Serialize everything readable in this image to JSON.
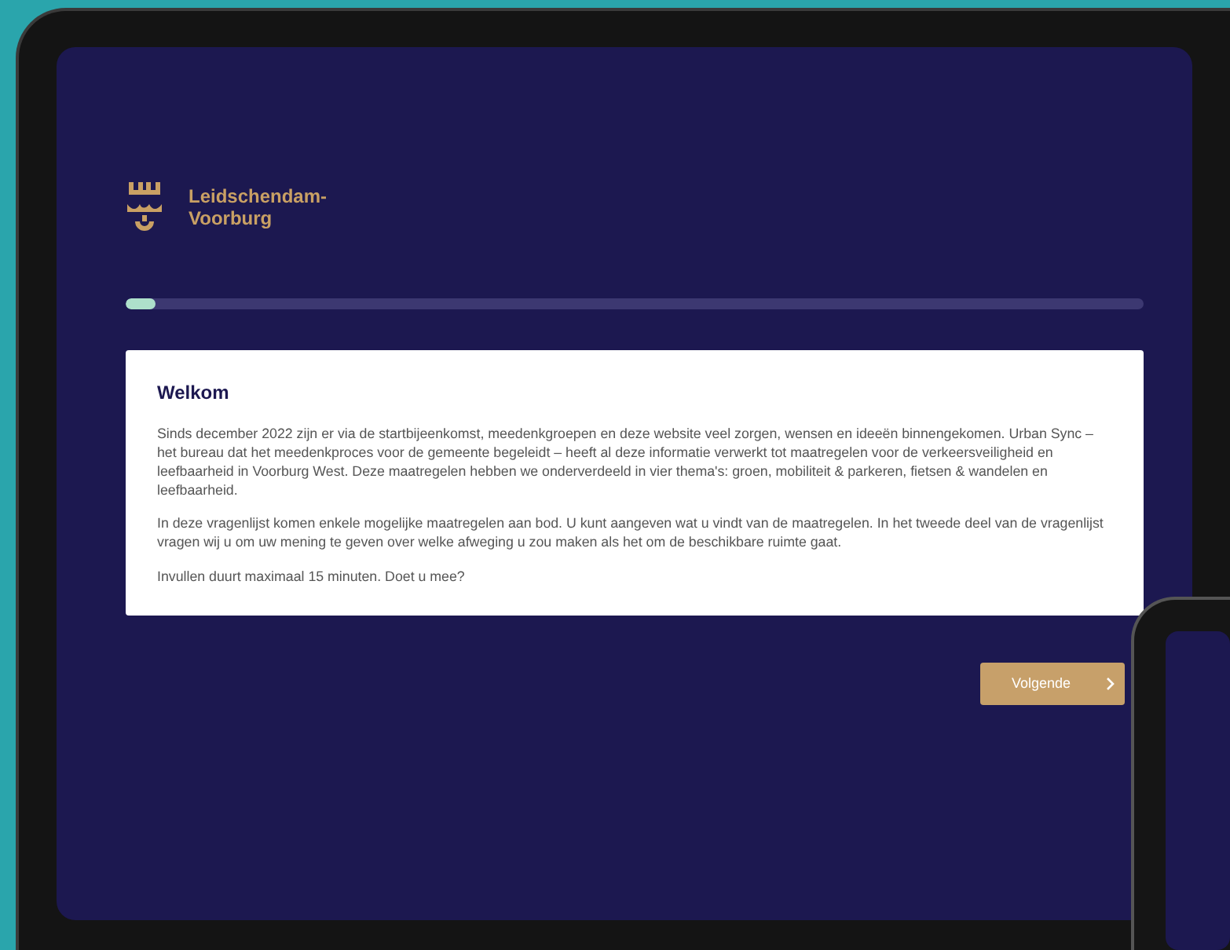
{
  "logo": {
    "lines": [
      "Leidschendam-",
      "Voorburg"
    ]
  },
  "progress": {
    "level": 0.03
  },
  "intro_card": {
    "title": "Welkom",
    "paragraphs": [
      "Sinds december 2022 zijn er via de startbijeenkomst, meedenkgroepen en deze website veel zorgen, wensen en ideeën binnengekomen. Urban Sync – het bureau dat het meedenkproces voor de gemeente begeleidt – heeft al deze informatie verwerkt tot maatregelen voor de verkeersveiligheid en leefbaarheid in Voorburg West. Deze maatregelen hebben we onderverdeeld in vier thema's: groen, mobiliteit & parkeren, fietsen & wandelen en leefbaarheid.",
      "In deze vragenlijst komen enkele mogelijke maatregelen aan bod. U kunt aangeven wat u vindt van de maatregelen. In het tweede deel van de vragenlijst vragen wij u om uw mening te geven over welke afweging u zou maken als het om de beschikbare ruimte gaat.",
      "Invullen duurt maximaal 15 minuten. Doet u mee?"
    ]
  },
  "next_button": {
    "label": "Volgende"
  }
}
